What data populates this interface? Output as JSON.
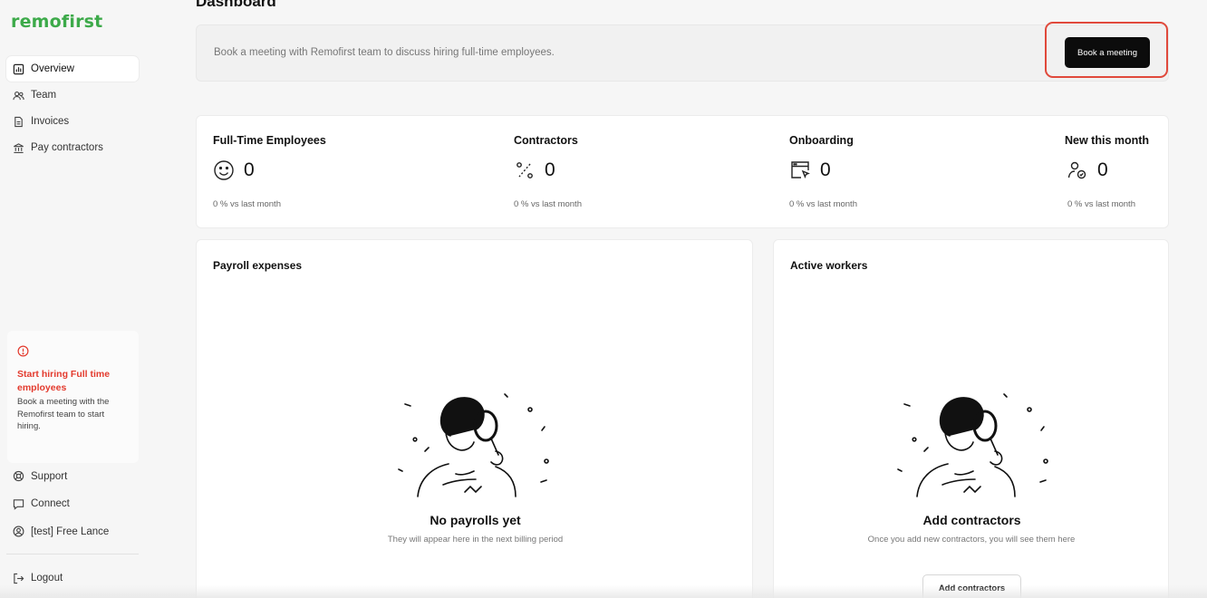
{
  "brand": {
    "logo_text": "remofirst",
    "logo_color": "#3daa4a"
  },
  "sidebar": {
    "items": [
      {
        "label": "Overview",
        "icon": "chart-icon",
        "active": true
      },
      {
        "label": "Team",
        "icon": "users-icon"
      },
      {
        "label": "Invoices",
        "icon": "document-icon"
      },
      {
        "label": "Pay contractors",
        "icon": "bank-icon"
      }
    ],
    "promo": {
      "icon": "info-icon",
      "title": "Start hiring Full time employees",
      "text": "Book a meeting with the Remofirst team to start hiring."
    },
    "bottom_items": [
      {
        "label": "Support",
        "icon": "lifebuoy-icon"
      },
      {
        "label": "Connect",
        "icon": "chat-icon"
      },
      {
        "label": "[test] Free Lance",
        "icon": "user-circle-icon"
      }
    ],
    "logout": {
      "label": "Logout",
      "icon": "logout-icon"
    }
  },
  "page": {
    "title": "Dashboard"
  },
  "banner": {
    "text": "Book a meeting with Remofirst team to discuss hiring full-time employees.",
    "button_label": "Book a meeting",
    "highlight_color": "#e0493b"
  },
  "stats": [
    {
      "label": "Full-Time Employees",
      "value": "0",
      "change": "0 %  vs last month",
      "icon": "smile-icon"
    },
    {
      "label": "Contractors",
      "value": "0",
      "change": "0 %  vs last month",
      "icon": "percent-icon"
    },
    {
      "label": "Onboarding",
      "value": "0",
      "change": "0 %  vs last month",
      "icon": "browser-cursor-icon"
    },
    {
      "label": "New this month",
      "value": "0",
      "change": "0 %  vs last month",
      "icon": "user-check-icon"
    }
  ],
  "payroll": {
    "title": "Payroll expenses",
    "empty_title": "No payrolls yet",
    "empty_text": "They will appear here in the next billing period"
  },
  "workers": {
    "title": "Active workers",
    "empty_title": "Add contractors",
    "empty_text": "Once you add new contractors, you will see them here",
    "button_label": "Add contractors"
  }
}
